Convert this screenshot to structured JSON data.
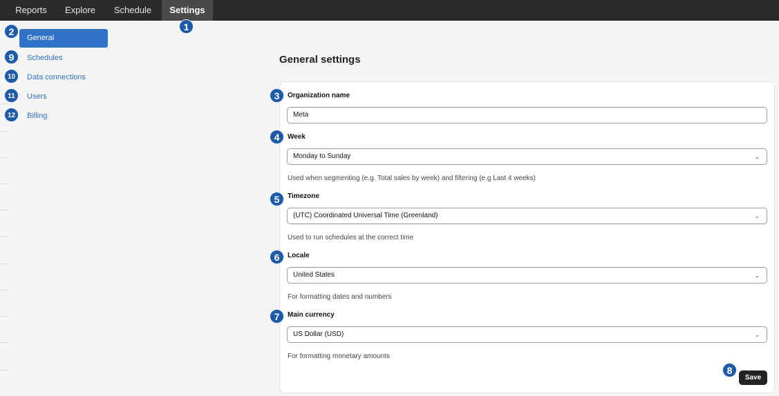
{
  "nav": {
    "tabs": [
      {
        "label": "Reports"
      },
      {
        "label": "Explore"
      },
      {
        "label": "Schedule"
      },
      {
        "label": "Settings"
      }
    ]
  },
  "sidebar": {
    "items": [
      {
        "label": "General",
        "badge": "2"
      },
      {
        "label": "Schedules",
        "badge": "9"
      },
      {
        "label": "Data connections",
        "badge": "10"
      },
      {
        "label": "Users",
        "badge": "11"
      },
      {
        "label": "Billing",
        "badge": "12"
      }
    ]
  },
  "badges": {
    "settings_tab": "1",
    "org_name": "3",
    "week": "4",
    "timezone": "5",
    "locale": "6",
    "currency": "7",
    "save": "8"
  },
  "main": {
    "title": "General settings",
    "org_name": {
      "label": "Organization name",
      "value": "Meta"
    },
    "week": {
      "label": "Week",
      "value": "Monday to Sunday",
      "help": "Used when segmenting (e.g. Total sales by week) and filtering (e.g Last 4 weeks)"
    },
    "timezone": {
      "label": "Timezone",
      "value": "(UTC) Coordinated Universal Time (Greenland)",
      "help": "Used to run schedules at the correct time"
    },
    "locale": {
      "label": "Locale",
      "value": "United States",
      "help": "For formatting dates and numbers"
    },
    "currency": {
      "label": "Main currency",
      "value": "US Dollar (USD)",
      "help": "For formatting monetary amounts"
    },
    "save_label": "Save"
  },
  "icons": {
    "dropdown": "chevron-down-icon",
    "chevron_glyph": "⌄"
  },
  "colors": {
    "accent": "#2f72c8",
    "badge": "#1f5aa6",
    "topbar": "#2b2b2b",
    "save_button": "#232323"
  }
}
